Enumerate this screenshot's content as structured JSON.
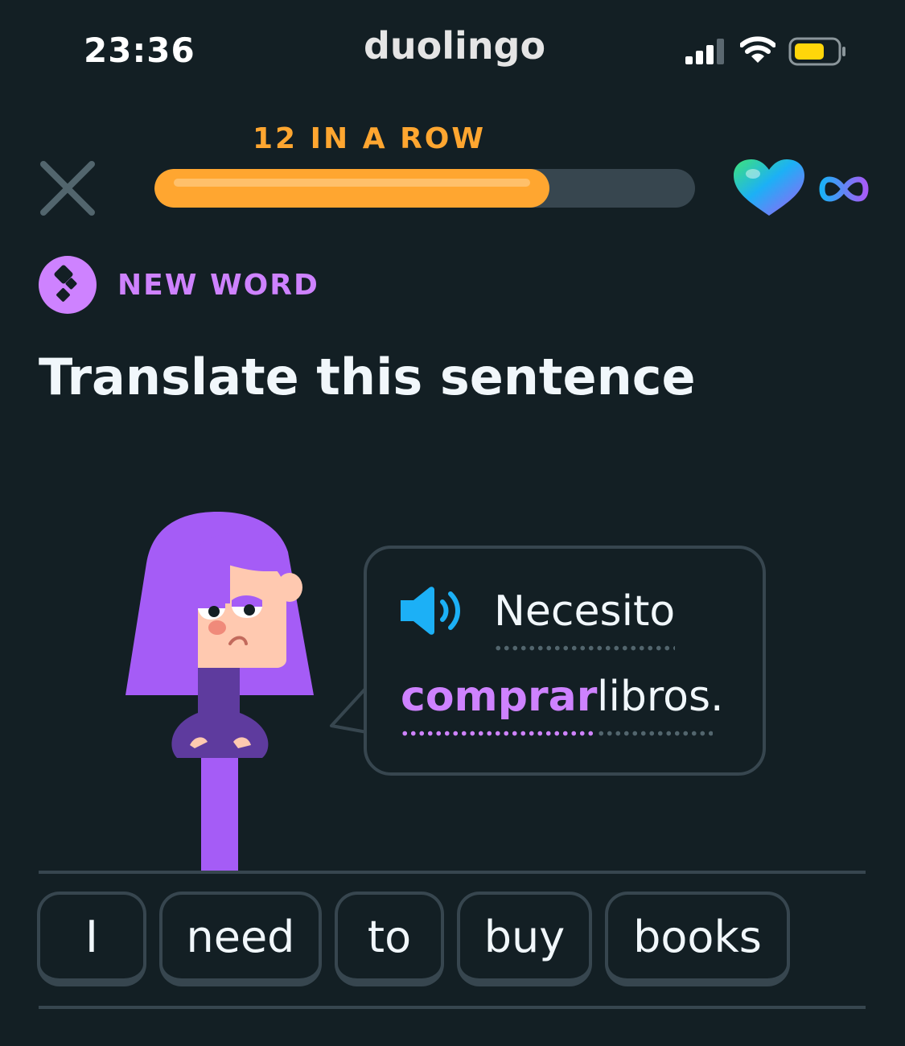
{
  "status_bar": {
    "time": "23:36",
    "app_name": "duolingo"
  },
  "header": {
    "close_icon": "x-close-icon",
    "streak_label": "12 IN A ROW",
    "progress_fraction": 0.73,
    "hearts_icon": "heart-icon",
    "hearts_value": "∞"
  },
  "challenge": {
    "badge_icon": "new-word-icon",
    "badge_label": "NEW WORD",
    "title": "Translate this sentence",
    "speaker_icon": "speaker-icon",
    "sentence": [
      {
        "text": "Necesito",
        "is_new": false
      },
      {
        "text": "comprar",
        "is_new": true
      },
      {
        "text": "libros.",
        "is_new": false
      }
    ]
  },
  "word_bank": [
    "I",
    "need",
    "to",
    "buy",
    "books"
  ],
  "colors": {
    "background": "#131f24",
    "accent_orange": "#ffa630",
    "accent_purple": "#ce82ff",
    "border": "#37464f",
    "speaker_blue": "#1cb0f6"
  }
}
